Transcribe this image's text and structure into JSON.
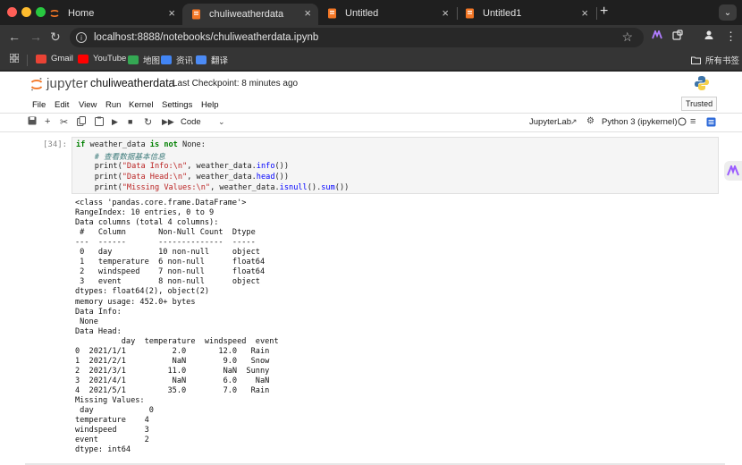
{
  "browser": {
    "tabs": [
      {
        "title": "Home",
        "active": false
      },
      {
        "title": "chuliweatherdata",
        "active": true
      },
      {
        "title": "Untitled",
        "active": false
      },
      {
        "title": "Untitled1",
        "active": false
      }
    ],
    "url": "localhost:8888/notebooks/chuliweatherdata.ipynb",
    "bookmarks": [
      "Gmail",
      "YouTube",
      "地图",
      "资讯",
      "翻译"
    ],
    "all_bookmarks_label": "所有书签"
  },
  "jupyter": {
    "logo_text": "jupyter",
    "notebook_name": "chuliweatherdata",
    "checkpoint": "Last Checkpoint: 8 minutes ago",
    "trusted": "Trusted",
    "menus": [
      "File",
      "Edit",
      "View",
      "Run",
      "Kernel",
      "Settings",
      "Help"
    ],
    "cell_type": "Code",
    "jupyterlab_label": "JupyterLab",
    "kernel_name": "Python 3 (ipykernel)"
  },
  "cell": {
    "prompt": "[34]:",
    "code": {
      "line1": {
        "kw1": "if",
        "mid": " weather_data ",
        "kw2": "is not",
        "tail": " None:"
      },
      "comment": "# 查看数据基本信息",
      "print1": {
        "str": "\"Data Info:\\n\"",
        "attr": "info"
      },
      "print2": {
        "str": "\"Data Head:\\n\"",
        "attr": "head"
      },
      "print3": {
        "str": "\"Missing Values:\\n\"",
        "attr1": "isnull",
        "attr2": "sum"
      }
    },
    "output_lines": [
      "<class 'pandas.core.frame.DataFrame'>",
      "RangeIndex: 10 entries, 0 to 9",
      "Data columns (total 4 columns):",
      " #   Column       Non-Null Count  Dtype  ",
      "---  ------       --------------  -----  ",
      " 0   day          10 non-null     object ",
      " 1   temperature  6 non-null      float64",
      " 2   windspeed    7 non-null      float64",
      " 3   event        8 non-null      object ",
      "dtypes: float64(2), object(2)",
      "memory usage: 452.0+ bytes",
      "Data Info:",
      " None",
      "Data Head:",
      "          day  temperature  windspeed  event",
      "0  2021/1/1          2.0       12.0   Rain",
      "1  2021/2/1          NaN        9.0   Snow",
      "2  2021/3/1         11.0        NaN  Sunny",
      "3  2021/4/1          NaN        6.0    NaN",
      "4  2021/5/1         35.0        7.0   Rain",
      "Missing Values:",
      " day            0",
      "temperature    4",
      "windspeed      3",
      "event          2",
      "dtype: int64"
    ]
  }
}
